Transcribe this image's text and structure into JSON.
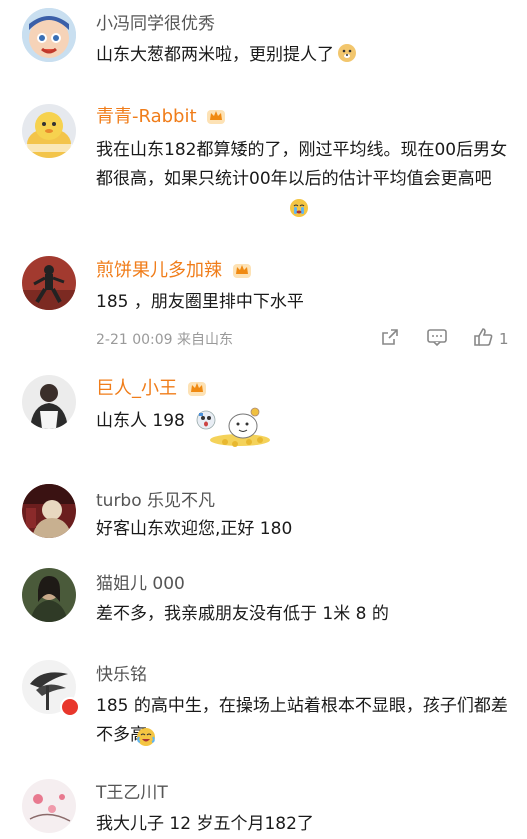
{
  "comments": [
    {
      "username": "小冯同学很优秀",
      "text": "山东大葱都两米啦，更别提人了"
    },
    {
      "username": "青青-Rabbit",
      "text": "我在山东182都算矮的了，刚过平均线。现在00后男女都很高，如果只统计00年以后的估计平均值会更高吧"
    },
    {
      "username": "煎饼果儿多加辣",
      "text": "185 ，朋友圈里排中下水平",
      "meta": "2-21 00:09  来自山东",
      "like_count": "1"
    },
    {
      "username": "巨人_小王",
      "text": "山东人 198"
    },
    {
      "username": "turbo 乐见不凡",
      "text": "好客山东欢迎您,正好 180"
    },
    {
      "username": "猫姐儿 000",
      "text": "差不多，我亲戚朋友没有低于 1米 8 的"
    },
    {
      "username": "快乐铭",
      "text": "185 的高中生，在操场上站着根本不显眼，孩子们都差不多高"
    },
    {
      "username": "T王乙川T",
      "text": "我大儿子 12 岁五个月182了"
    }
  ],
  "colors": {
    "vip_name": "#f07d1a",
    "name": "#555555",
    "meta": "#9a9a9a"
  }
}
